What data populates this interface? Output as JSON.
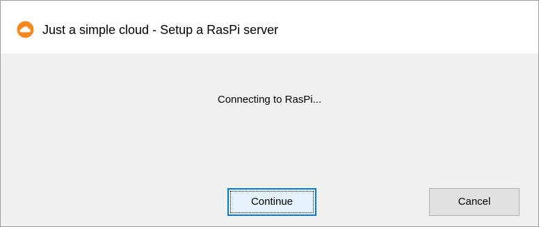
{
  "window": {
    "title": "Just a simple cloud - Setup a RasPi server",
    "icon": "cloud-app-icon"
  },
  "dialog": {
    "status_message": "Connecting to RasPi..."
  },
  "buttons": {
    "continue_label": "Continue",
    "cancel_label": "Cancel"
  },
  "colors": {
    "icon_orange": "#f5891f",
    "focus_blue": "#0078d7",
    "window_bg": "#f0f0f0",
    "titlebar_bg": "#ffffff"
  }
}
